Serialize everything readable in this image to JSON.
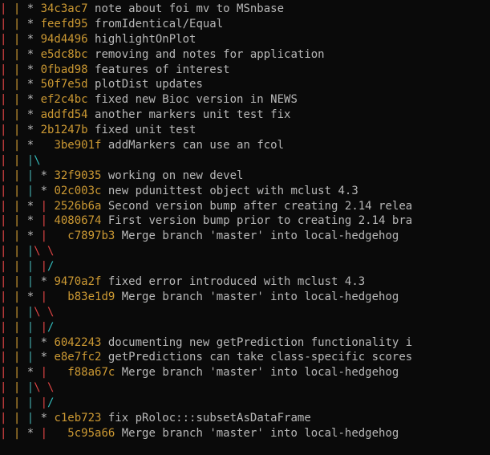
{
  "lines": [
    {
      "graph": [
        [
          "red",
          "| "
        ],
        [
          "yellow",
          "| "
        ],
        [
          "gray",
          "* "
        ]
      ],
      "hash": "34c3ac7",
      "msg": " note about foi mv to MSnbase"
    },
    {
      "graph": [
        [
          "red",
          "| "
        ],
        [
          "yellow",
          "| "
        ],
        [
          "gray",
          "* "
        ]
      ],
      "hash": "feefd95",
      "msg": " fromIdentical/Equal"
    },
    {
      "graph": [
        [
          "red",
          "| "
        ],
        [
          "yellow",
          "| "
        ],
        [
          "gray",
          "* "
        ]
      ],
      "hash": "94d4496",
      "msg": " highlightOnPlot"
    },
    {
      "graph": [
        [
          "red",
          "| "
        ],
        [
          "yellow",
          "| "
        ],
        [
          "gray",
          "* "
        ]
      ],
      "hash": "e5dc8bc",
      "msg": " removing and notes for application"
    },
    {
      "graph": [
        [
          "red",
          "| "
        ],
        [
          "yellow",
          "| "
        ],
        [
          "gray",
          "* "
        ]
      ],
      "hash": "0fbad98",
      "msg": " features of interest"
    },
    {
      "graph": [
        [
          "red",
          "| "
        ],
        [
          "yellow",
          "| "
        ],
        [
          "gray",
          "* "
        ]
      ],
      "hash": "50f7e5d",
      "msg": " plotDist updates"
    },
    {
      "graph": [
        [
          "red",
          "| "
        ],
        [
          "yellow",
          "| "
        ],
        [
          "gray",
          "* "
        ]
      ],
      "hash": "ef2c4bc",
      "msg": " fixed new Bioc version in NEWS"
    },
    {
      "graph": [
        [
          "red",
          "| "
        ],
        [
          "yellow",
          "| "
        ],
        [
          "gray",
          "* "
        ]
      ],
      "hash": "addfd54",
      "msg": " another markers unit test fix"
    },
    {
      "graph": [
        [
          "red",
          "| "
        ],
        [
          "yellow",
          "| "
        ],
        [
          "gray",
          "* "
        ]
      ],
      "hash": "2b1247b",
      "msg": " fixed unit test"
    },
    {
      "graph": [
        [
          "red",
          "| "
        ],
        [
          "yellow",
          "| "
        ],
        [
          "gray",
          "*   "
        ]
      ],
      "hash": "3be901f",
      "msg": " addMarkers can use an fcol"
    },
    {
      "graph": [
        [
          "red",
          "| "
        ],
        [
          "yellow",
          "| "
        ],
        [
          "blue",
          "|"
        ],
        [
          "cyan",
          "\\"
        ]
      ],
      "hash": "",
      "msg": ""
    },
    {
      "graph": [
        [
          "red",
          "| "
        ],
        [
          "yellow",
          "| "
        ],
        [
          "blue",
          "| "
        ],
        [
          "gray",
          "* "
        ]
      ],
      "hash": "32f9035",
      "msg": " working on new devel"
    },
    {
      "graph": [
        [
          "red",
          "| "
        ],
        [
          "yellow",
          "| "
        ],
        [
          "blue",
          "| "
        ],
        [
          "gray",
          "* "
        ]
      ],
      "hash": "02c003c",
      "msg": " new pdunittest object with mclust 4.3"
    },
    {
      "graph": [
        [
          "red",
          "| "
        ],
        [
          "yellow",
          "| "
        ],
        [
          "gray",
          "* "
        ],
        [
          "red",
          "| "
        ]
      ],
      "hash": "2526b6a",
      "msg": " Second version bump after creating 2.14 relea"
    },
    {
      "graph": [
        [
          "red",
          "| "
        ],
        [
          "yellow",
          "| "
        ],
        [
          "gray",
          "* "
        ],
        [
          "red",
          "| "
        ]
      ],
      "hash": "4080674",
      "msg": " First version bump prior to creating 2.14 bra"
    },
    {
      "graph": [
        [
          "red",
          "| "
        ],
        [
          "yellow",
          "| "
        ],
        [
          "gray",
          "* "
        ],
        [
          "red",
          "|   "
        ]
      ],
      "hash": "c7897b3",
      "msg": " Merge branch 'master' into local-hedgehog"
    },
    {
      "graph": [
        [
          "red",
          "| "
        ],
        [
          "yellow",
          "| "
        ],
        [
          "blue",
          "|"
        ],
        [
          "red",
          "\\ \\"
        ]
      ],
      "hash": "",
      "msg": ""
    },
    {
      "graph": [
        [
          "red",
          "| "
        ],
        [
          "yellow",
          "| "
        ],
        [
          "blue",
          "| "
        ],
        [
          "red",
          "|"
        ],
        [
          "cyan",
          "/"
        ]
      ],
      "hash": "",
      "msg": ""
    },
    {
      "graph": [
        [
          "red",
          "| "
        ],
        [
          "yellow",
          "| "
        ],
        [
          "blue",
          "| "
        ],
        [
          "gray",
          "* "
        ]
      ],
      "hash": "9470a2f",
      "msg": " fixed error introduced with mclust 4.3"
    },
    {
      "graph": [
        [
          "red",
          "| "
        ],
        [
          "yellow",
          "| "
        ],
        [
          "gray",
          "* "
        ],
        [
          "red",
          "|   "
        ]
      ],
      "hash": "b83e1d9",
      "msg": " Merge branch 'master' into local-hedgehog"
    },
    {
      "graph": [
        [
          "red",
          "| "
        ],
        [
          "yellow",
          "| "
        ],
        [
          "blue",
          "|"
        ],
        [
          "red",
          "\\ \\"
        ]
      ],
      "hash": "",
      "msg": ""
    },
    {
      "graph": [
        [
          "red",
          "| "
        ],
        [
          "yellow",
          "| "
        ],
        [
          "blue",
          "| "
        ],
        [
          "red",
          "|"
        ],
        [
          "cyan",
          "/"
        ]
      ],
      "hash": "",
      "msg": ""
    },
    {
      "graph": [
        [
          "red",
          "| "
        ],
        [
          "yellow",
          "| "
        ],
        [
          "blue",
          "| "
        ],
        [
          "gray",
          "* "
        ]
      ],
      "hash": "6042243",
      "msg": " documenting new getPrediction functionality i"
    },
    {
      "graph": [
        [
          "red",
          "| "
        ],
        [
          "yellow",
          "| "
        ],
        [
          "blue",
          "| "
        ],
        [
          "gray",
          "* "
        ]
      ],
      "hash": "e8e7fc2",
      "msg": " getPredictions can take class-specific scores"
    },
    {
      "graph": [
        [
          "red",
          "| "
        ],
        [
          "yellow",
          "| "
        ],
        [
          "gray",
          "* "
        ],
        [
          "red",
          "|   "
        ]
      ],
      "hash": "f88a67c",
      "msg": " Merge branch 'master' into local-hedgehog"
    },
    {
      "graph": [
        [
          "red",
          "| "
        ],
        [
          "yellow",
          "| "
        ],
        [
          "blue",
          "|"
        ],
        [
          "red",
          "\\ \\"
        ]
      ],
      "hash": "",
      "msg": ""
    },
    {
      "graph": [
        [
          "red",
          "| "
        ],
        [
          "yellow",
          "| "
        ],
        [
          "blue",
          "| "
        ],
        [
          "red",
          "|"
        ],
        [
          "cyan",
          "/"
        ]
      ],
      "hash": "",
      "msg": ""
    },
    {
      "graph": [
        [
          "red",
          "| "
        ],
        [
          "yellow",
          "| "
        ],
        [
          "blue",
          "| "
        ],
        [
          "gray",
          "* "
        ]
      ],
      "hash": "c1eb723",
      "msg": " fix pRoloc:::subsetAsDataFrame"
    },
    {
      "graph": [
        [
          "red",
          "| "
        ],
        [
          "yellow",
          "| "
        ],
        [
          "gray",
          "* "
        ],
        [
          "red",
          "|   "
        ]
      ],
      "hash": "5c95a66",
      "msg": " Merge branch 'master' into local-hedgehog"
    }
  ]
}
